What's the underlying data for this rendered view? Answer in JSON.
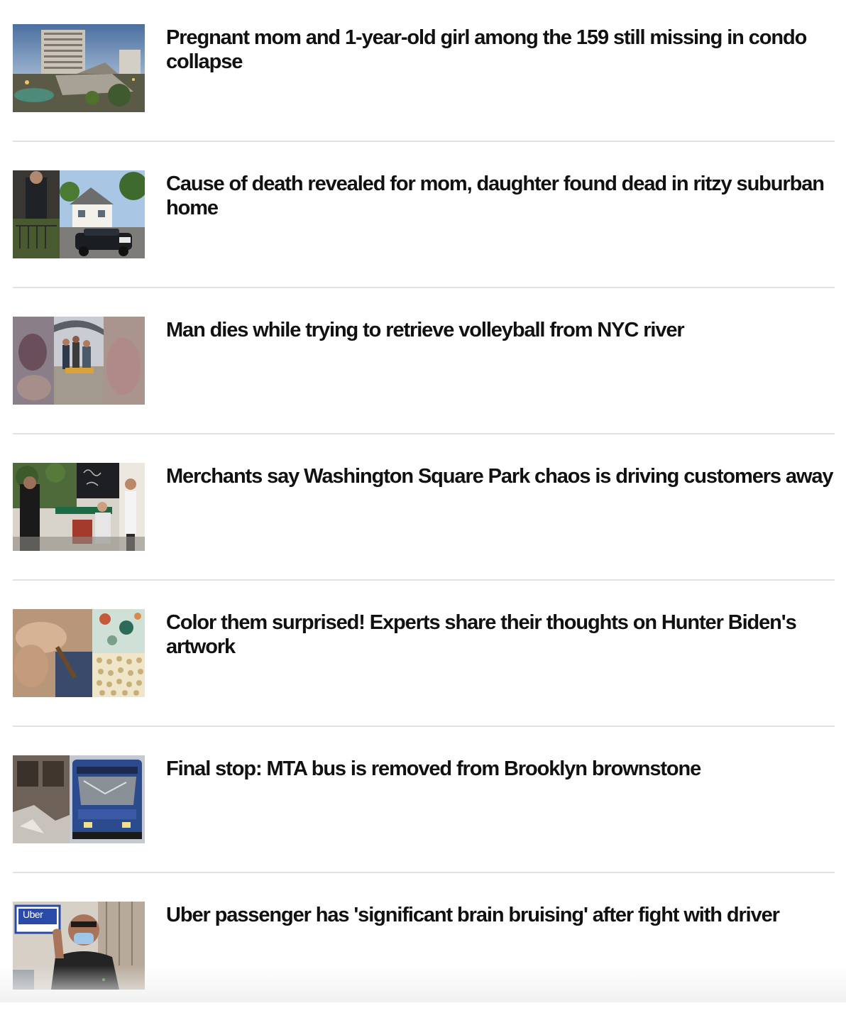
{
  "stories": [
    {
      "headline": "Pregnant mom and 1-year-old girl among the 159 still missing in condo collapse",
      "thumbnail": "condo-collapse-photo"
    },
    {
      "headline": "Cause of death revealed for mom, daughter found dead in ritzy suburban home",
      "thumbnail": "suburban-home-police-photo"
    },
    {
      "headline": "Man dies while trying to retrieve volleyball from NYC river",
      "thumbnail": "river-rescue-photo"
    },
    {
      "headline": "Merchants say Washington Square Park chaos is driving customers away",
      "thumbnail": "washington-square-photo"
    },
    {
      "headline": "Color them surprised! Experts share their thoughts on Hunter Biden's artwork",
      "thumbnail": "artwork-photo"
    },
    {
      "headline": "Final stop: MTA bus is removed from Brooklyn brownstone",
      "thumbnail": "mta-bus-photo"
    },
    {
      "headline": "Uber passenger has 'significant brain bruising' after fight with driver",
      "thumbnail": "uber-passenger-photo"
    }
  ],
  "colors": {
    "headline": "#111111",
    "divider": "#e2e2e2",
    "background": "#ffffff"
  }
}
